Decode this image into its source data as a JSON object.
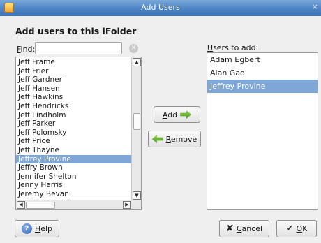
{
  "window": {
    "title": "Add Users",
    "close_glyph": "×"
  },
  "heading": "Add users to this iFolder",
  "find": {
    "label_mnemonic": "F",
    "label_rest": "ind:",
    "value": "",
    "clear_icon": "clear-icon"
  },
  "available_users": [
    "Jeff Frame",
    "Jeff Frier",
    "Jeff Gardner",
    "Jeff Hansen",
    "Jeff Hawkins",
    "Jeff Hendricks",
    "Jeff Lindholm",
    "Jeff Parker",
    "Jeff Polomsky",
    "Jeff Price",
    "Jeff Thayne",
    "Jeffrey Provine",
    "Jeffry Brown",
    "Jennifer Shelton",
    "Jenny Harris",
    "Jeremy Bevan"
  ],
  "available_selected": "Jeffrey Provine",
  "add_button": {
    "mnemonic": "A",
    "rest": "dd",
    "icon": "arrow-right-icon"
  },
  "remove_button": {
    "mnemonic": "R",
    "rest": "emove",
    "icon": "arrow-left-icon"
  },
  "users_to_add": {
    "label_mnemonic": "U",
    "label_rest": "sers to add:",
    "items": [
      "Adam Egbert",
      "Alan Gao",
      "Jeffrey Provine"
    ],
    "selected": "Jeffrey Provine"
  },
  "help_button": {
    "mnemonic": "H",
    "rest": "elp",
    "icon": "help-icon"
  },
  "cancel_button": {
    "mnemonic": "C",
    "rest": "ancel",
    "icon": "cancel-icon"
  },
  "ok_button": {
    "mnemonic": "O",
    "rest": "K",
    "icon": "ok-icon"
  },
  "colors": {
    "selection": "#7ea6d6",
    "titlebar": "#4f86c6"
  }
}
